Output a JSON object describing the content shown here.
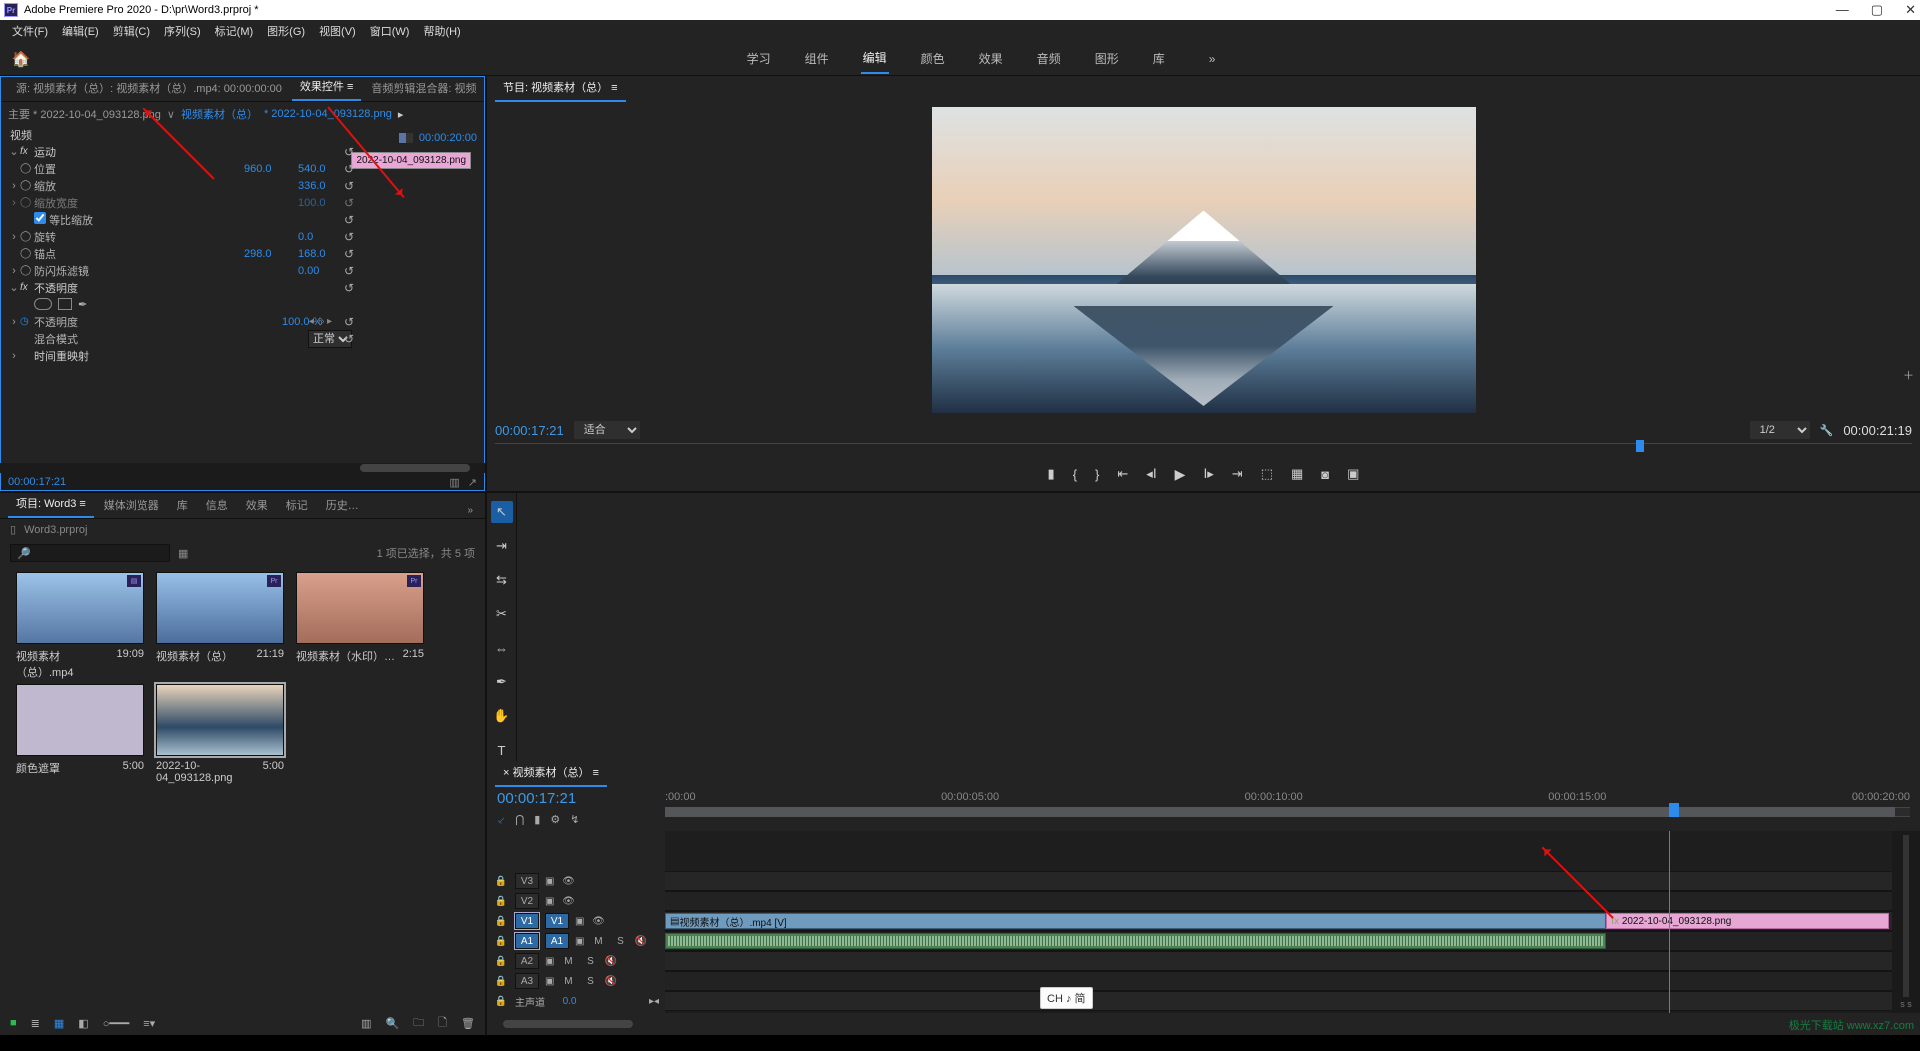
{
  "app": {
    "title": "Adobe Premiere Pro 2020 - D:\\pr\\Word3.prproj *",
    "menu": [
      "文件(F)",
      "编辑(E)",
      "剪辑(C)",
      "序列(S)",
      "标记(M)",
      "图形(G)",
      "视图(V)",
      "窗口(W)",
      "帮助(H)"
    ],
    "workspaces": [
      "学习",
      "组件",
      "编辑",
      "颜色",
      "效果",
      "音频",
      "图形",
      "库"
    ],
    "workspace_active": 2
  },
  "source_panel": {
    "tabs": {
      "source": "源: 视频素材（总）: 视频素材（总）.mp4: 00:00:00:00",
      "effect_controls": "效果控件",
      "audio_mixer": "音频剪辑混合器: 视频"
    },
    "header": {
      "main_clip": "主要 * 2022-10-04_093128.png",
      "seq_link": "视频素材（总）",
      "seq_clip": "* 2022-10-04_093128.png",
      "right_tc": "00:00:20:00"
    },
    "clip_chip": "2022-10-04_093128.png",
    "groups": {
      "video": "视频",
      "motion": "运动",
      "position": "位置",
      "position_x": "960.0",
      "position_y": "540.0",
      "scale": "缩放",
      "scale_val": "336.0",
      "scale_width": "缩放宽度",
      "scale_width_val": "100.0",
      "uniform": "等比缩放",
      "rotation": "旋转",
      "rotation_val": "0.0",
      "anchor": "锚点",
      "anchor_x": "298.0",
      "anchor_y": "168.0",
      "antiflicker": "防闪烁滤镜",
      "antiflicker_val": "0.00",
      "opacity_group": "不透明度",
      "opacity": "不透明度",
      "opacity_val": "100.0 %",
      "blend": "混合模式",
      "blend_val": "正常",
      "timeremap": "时间重映射"
    },
    "footer_tc": "00:00:17:21"
  },
  "program": {
    "tab": "节目: 视频素材（总）",
    "left_tc": "00:00:17:21",
    "fit": "适合",
    "res": "1/2",
    "right_tc": "00:00:21:19"
  },
  "project": {
    "tabs": [
      "项目: Word3",
      "媒体浏览器",
      "库",
      "信息",
      "效果",
      "标记",
      "历史…"
    ],
    "file": "Word3.prproj",
    "status": "1 项已选择，共 5 项",
    "bins": [
      {
        "name": "视频素材（总）.mp4",
        "dur": "19:09",
        "type": "video"
      },
      {
        "name": "视频素材（总）",
        "dur": "21:19",
        "type": "seq"
      },
      {
        "name": "视频素材（水印）…",
        "dur": "2:15",
        "type": "seq"
      },
      {
        "name": "颜色遮罩",
        "dur": "5:00",
        "type": "matte"
      },
      {
        "name": "2022-10-04_093128.png",
        "dur": "5:00",
        "type": "img"
      }
    ]
  },
  "timeline": {
    "tab": "视频素材（总）",
    "tc": "00:00:17:21",
    "marks": [
      ":00:00",
      "00:00:05:00",
      "00:00:10:00",
      "00:00:15:00",
      "00:00:20:00"
    ],
    "tracks": {
      "v3": "V3",
      "v2": "V2",
      "v1": "V1",
      "a1": "A1",
      "a2": "A2",
      "a3": "A3",
      "master": "主声道",
      "master_val": "0.0"
    },
    "clip_video": "视频素材（总）.mp4 [V]",
    "clip_png": "2022-10-04_093128.png"
  },
  "ime": "CH ♪ 简",
  "watermark": "极光下载站\nwww.xz7.com"
}
